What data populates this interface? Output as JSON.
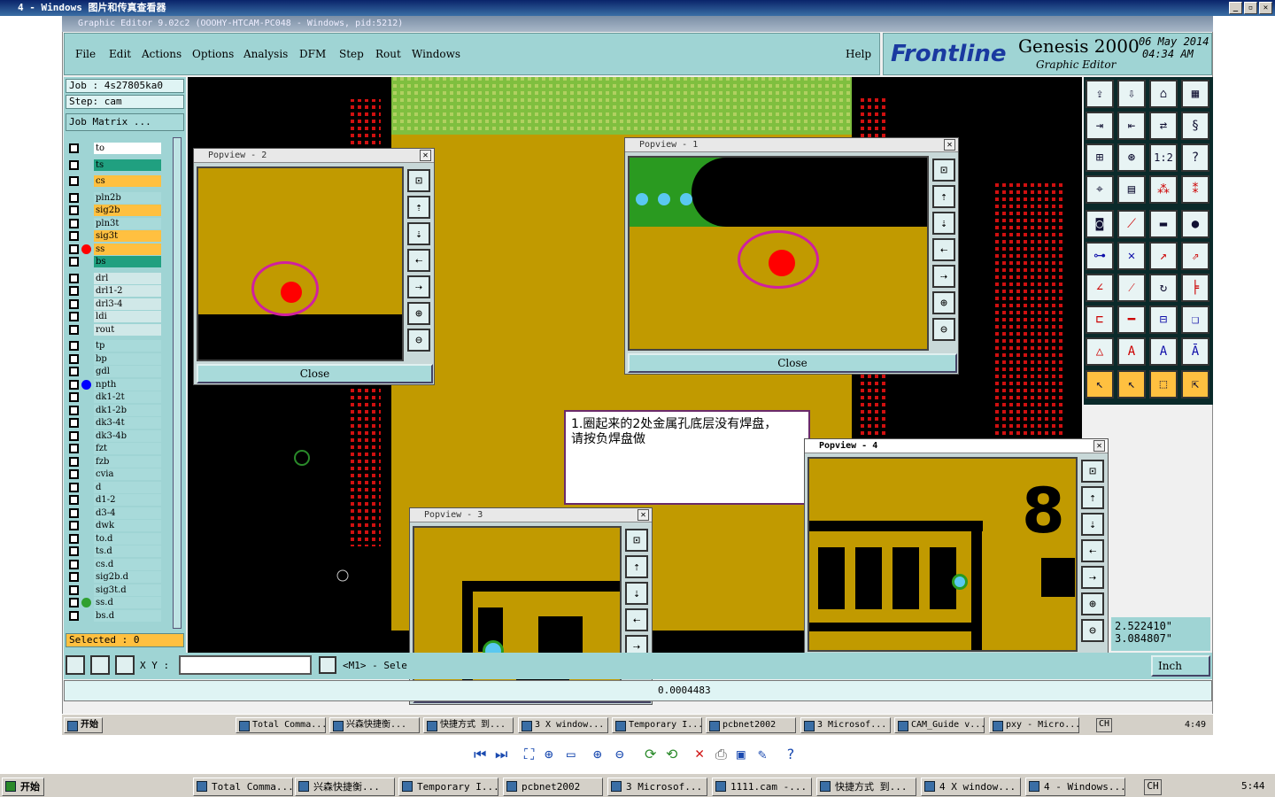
{
  "viewer": {
    "title": "4 - Windows 图片和传真查看器"
  },
  "genesis": {
    "title": "Graphic Editor 9.02c2  (OOOHY-HTCAM-PC048 - Windows, pid:5212)"
  },
  "menu": {
    "items": [
      "File",
      "Edit",
      "Actions",
      "Options",
      "Analysis",
      "DFM",
      "Step",
      "Rout",
      "Windows"
    ],
    "help": "Help"
  },
  "brand": {
    "logo": "Frontline",
    "product": "Genesis 2000",
    "subtitle": "Graphic Editor",
    "date": "06 May 2014",
    "time": "04:34 AM"
  },
  "job": {
    "job": "Job : 4s27805ka0",
    "step": "Step: cam",
    "matrix": "Job Matrix ..."
  },
  "layers": [
    {
      "name": "to",
      "color": "#ffffff",
      "dot": ""
    },
    {
      "name": "ts",
      "color": "#20a080",
      "dot": ""
    },
    {
      "name": "cs",
      "color": "#ffc040",
      "dot": ""
    },
    {
      "name": "pln2b",
      "color": "#a8dada",
      "dot": ""
    },
    {
      "name": "sig2b",
      "color": "#ffc040",
      "dot": ""
    },
    {
      "name": "pln3t",
      "color": "#a8dada",
      "dot": ""
    },
    {
      "name": "sig3t",
      "color": "#ffc040",
      "dot": ""
    },
    {
      "name": "ss",
      "color": "#ffc040",
      "dot": "#ff0000"
    },
    {
      "name": "bs",
      "color": "#20a080",
      "dot": ""
    },
    {
      "name": "drl",
      "color": "#d0e8e8",
      "dot": ""
    },
    {
      "name": "drl1-2",
      "color": "#d0e8e8",
      "dot": ""
    },
    {
      "name": "drl3-4",
      "color": "#d0e8e8",
      "dot": ""
    },
    {
      "name": "ldi",
      "color": "#d0e8e8",
      "dot": ""
    },
    {
      "name": "rout",
      "color": "#d0e8e8",
      "dot": ""
    },
    {
      "name": "tp",
      "color": "#a8dada",
      "dot": ""
    },
    {
      "name": "bp",
      "color": "#a8dada",
      "dot": ""
    },
    {
      "name": "gdl",
      "color": "#a8dada",
      "dot": ""
    },
    {
      "name": "npth",
      "color": "#a8dada",
      "dot": "#0000ff"
    },
    {
      "name": "dk1-2t",
      "color": "#a8dada",
      "dot": ""
    },
    {
      "name": "dk1-2b",
      "color": "#a8dada",
      "dot": ""
    },
    {
      "name": "dk3-4t",
      "color": "#a8dada",
      "dot": ""
    },
    {
      "name": "dk3-4b",
      "color": "#a8dada",
      "dot": ""
    },
    {
      "name": "fzt",
      "color": "#a8dada",
      "dot": ""
    },
    {
      "name": "fzb",
      "color": "#a8dada",
      "dot": ""
    },
    {
      "name": "cvia",
      "color": "#a8dada",
      "dot": ""
    },
    {
      "name": "d",
      "color": "#a8dada",
      "dot": ""
    },
    {
      "name": "d1-2",
      "color": "#a8dada",
      "dot": ""
    },
    {
      "name": "d3-4",
      "color": "#a8dada",
      "dot": ""
    },
    {
      "name": "dwk",
      "color": "#a8dada",
      "dot": ""
    },
    {
      "name": "to.d",
      "color": "#a8dada",
      "dot": ""
    },
    {
      "name": "ts.d",
      "color": "#a8dada",
      "dot": ""
    },
    {
      "name": "cs.d",
      "color": "#a8dada",
      "dot": ""
    },
    {
      "name": "sig2b.d",
      "color": "#a8dada",
      "dot": ""
    },
    {
      "name": "sig3t.d",
      "color": "#a8dada",
      "dot": ""
    },
    {
      "name": "ss.d",
      "color": "#a8dada",
      "dot": "#30a030"
    },
    {
      "name": "bs.d",
      "color": "#a8dada",
      "dot": ""
    }
  ],
  "selected": "Selected : 0",
  "popviews": {
    "p1": "Popview - 1",
    "p2": "Popview - 2",
    "p3": "Popview - 3",
    "p4": "Popview - 4",
    "close": "Close"
  },
  "note": {
    "line1": "1.圈起来的2处金属孔底层没有焊盘，",
    "line2": "请按负焊盘做"
  },
  "coords": {
    "x": "2.522410\"",
    "y": "3.084807\"",
    "units": "Inch"
  },
  "xy": {
    "label": "X Y :",
    "m1": "<M1> - Sele"
  },
  "status": {
    "value": "0.0004483"
  },
  "inner_taskbar": {
    "start": "开始",
    "items": [
      "Total Comma...",
      "兴森快捷衡...",
      "快捷方式 到...",
      "3 X window...",
      "Temporary I...",
      "pcbnet2002",
      "3 Microsof...",
      "CAM_Guide v...",
      "pxy - Micro..."
    ],
    "lang": "CH",
    "clock": "4:49"
  },
  "taskbar": {
    "start": "开始",
    "items": [
      "Total Comma...",
      "兴森快捷衡...",
      "Temporary I...",
      "pcbnet2002",
      "3 Microsof...",
      "1111.cam -...",
      "快捷方式 到...",
      "4 X window...",
      "4 - Windows..."
    ],
    "lang": "CH",
    "clock": "5:44"
  },
  "colors": {
    "board": "#c19a00",
    "panel": "#9fd4d4",
    "accent": "#1a3aa0"
  }
}
